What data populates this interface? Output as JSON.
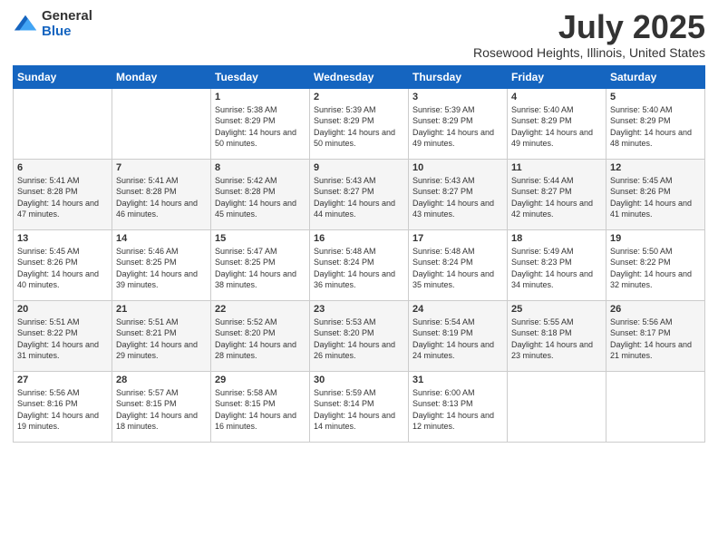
{
  "header": {
    "logo_general": "General",
    "logo_blue": "Blue",
    "month": "July 2025",
    "location": "Rosewood Heights, Illinois, United States"
  },
  "weekdays": [
    "Sunday",
    "Monday",
    "Tuesday",
    "Wednesday",
    "Thursday",
    "Friday",
    "Saturday"
  ],
  "weeks": [
    [
      {
        "day": "",
        "info": ""
      },
      {
        "day": "",
        "info": ""
      },
      {
        "day": "1",
        "info": "Sunrise: 5:38 AM\nSunset: 8:29 PM\nDaylight: 14 hours and 50 minutes."
      },
      {
        "day": "2",
        "info": "Sunrise: 5:39 AM\nSunset: 8:29 PM\nDaylight: 14 hours and 50 minutes."
      },
      {
        "day": "3",
        "info": "Sunrise: 5:39 AM\nSunset: 8:29 PM\nDaylight: 14 hours and 49 minutes."
      },
      {
        "day": "4",
        "info": "Sunrise: 5:40 AM\nSunset: 8:29 PM\nDaylight: 14 hours and 49 minutes."
      },
      {
        "day": "5",
        "info": "Sunrise: 5:40 AM\nSunset: 8:29 PM\nDaylight: 14 hours and 48 minutes."
      }
    ],
    [
      {
        "day": "6",
        "info": "Sunrise: 5:41 AM\nSunset: 8:28 PM\nDaylight: 14 hours and 47 minutes."
      },
      {
        "day": "7",
        "info": "Sunrise: 5:41 AM\nSunset: 8:28 PM\nDaylight: 14 hours and 46 minutes."
      },
      {
        "day": "8",
        "info": "Sunrise: 5:42 AM\nSunset: 8:28 PM\nDaylight: 14 hours and 45 minutes."
      },
      {
        "day": "9",
        "info": "Sunrise: 5:43 AM\nSunset: 8:27 PM\nDaylight: 14 hours and 44 minutes."
      },
      {
        "day": "10",
        "info": "Sunrise: 5:43 AM\nSunset: 8:27 PM\nDaylight: 14 hours and 43 minutes."
      },
      {
        "day": "11",
        "info": "Sunrise: 5:44 AM\nSunset: 8:27 PM\nDaylight: 14 hours and 42 minutes."
      },
      {
        "day": "12",
        "info": "Sunrise: 5:45 AM\nSunset: 8:26 PM\nDaylight: 14 hours and 41 minutes."
      }
    ],
    [
      {
        "day": "13",
        "info": "Sunrise: 5:45 AM\nSunset: 8:26 PM\nDaylight: 14 hours and 40 minutes."
      },
      {
        "day": "14",
        "info": "Sunrise: 5:46 AM\nSunset: 8:25 PM\nDaylight: 14 hours and 39 minutes."
      },
      {
        "day": "15",
        "info": "Sunrise: 5:47 AM\nSunset: 8:25 PM\nDaylight: 14 hours and 38 minutes."
      },
      {
        "day": "16",
        "info": "Sunrise: 5:48 AM\nSunset: 8:24 PM\nDaylight: 14 hours and 36 minutes."
      },
      {
        "day": "17",
        "info": "Sunrise: 5:48 AM\nSunset: 8:24 PM\nDaylight: 14 hours and 35 minutes."
      },
      {
        "day": "18",
        "info": "Sunrise: 5:49 AM\nSunset: 8:23 PM\nDaylight: 14 hours and 34 minutes."
      },
      {
        "day": "19",
        "info": "Sunrise: 5:50 AM\nSunset: 8:22 PM\nDaylight: 14 hours and 32 minutes."
      }
    ],
    [
      {
        "day": "20",
        "info": "Sunrise: 5:51 AM\nSunset: 8:22 PM\nDaylight: 14 hours and 31 minutes."
      },
      {
        "day": "21",
        "info": "Sunrise: 5:51 AM\nSunset: 8:21 PM\nDaylight: 14 hours and 29 minutes."
      },
      {
        "day": "22",
        "info": "Sunrise: 5:52 AM\nSunset: 8:20 PM\nDaylight: 14 hours and 28 minutes."
      },
      {
        "day": "23",
        "info": "Sunrise: 5:53 AM\nSunset: 8:20 PM\nDaylight: 14 hours and 26 minutes."
      },
      {
        "day": "24",
        "info": "Sunrise: 5:54 AM\nSunset: 8:19 PM\nDaylight: 14 hours and 24 minutes."
      },
      {
        "day": "25",
        "info": "Sunrise: 5:55 AM\nSunset: 8:18 PM\nDaylight: 14 hours and 23 minutes."
      },
      {
        "day": "26",
        "info": "Sunrise: 5:56 AM\nSunset: 8:17 PM\nDaylight: 14 hours and 21 minutes."
      }
    ],
    [
      {
        "day": "27",
        "info": "Sunrise: 5:56 AM\nSunset: 8:16 PM\nDaylight: 14 hours and 19 minutes."
      },
      {
        "day": "28",
        "info": "Sunrise: 5:57 AM\nSunset: 8:15 PM\nDaylight: 14 hours and 18 minutes."
      },
      {
        "day": "29",
        "info": "Sunrise: 5:58 AM\nSunset: 8:15 PM\nDaylight: 14 hours and 16 minutes."
      },
      {
        "day": "30",
        "info": "Sunrise: 5:59 AM\nSunset: 8:14 PM\nDaylight: 14 hours and 14 minutes."
      },
      {
        "day": "31",
        "info": "Sunrise: 6:00 AM\nSunset: 8:13 PM\nDaylight: 14 hours and 12 minutes."
      },
      {
        "day": "",
        "info": ""
      },
      {
        "day": "",
        "info": ""
      }
    ]
  ]
}
